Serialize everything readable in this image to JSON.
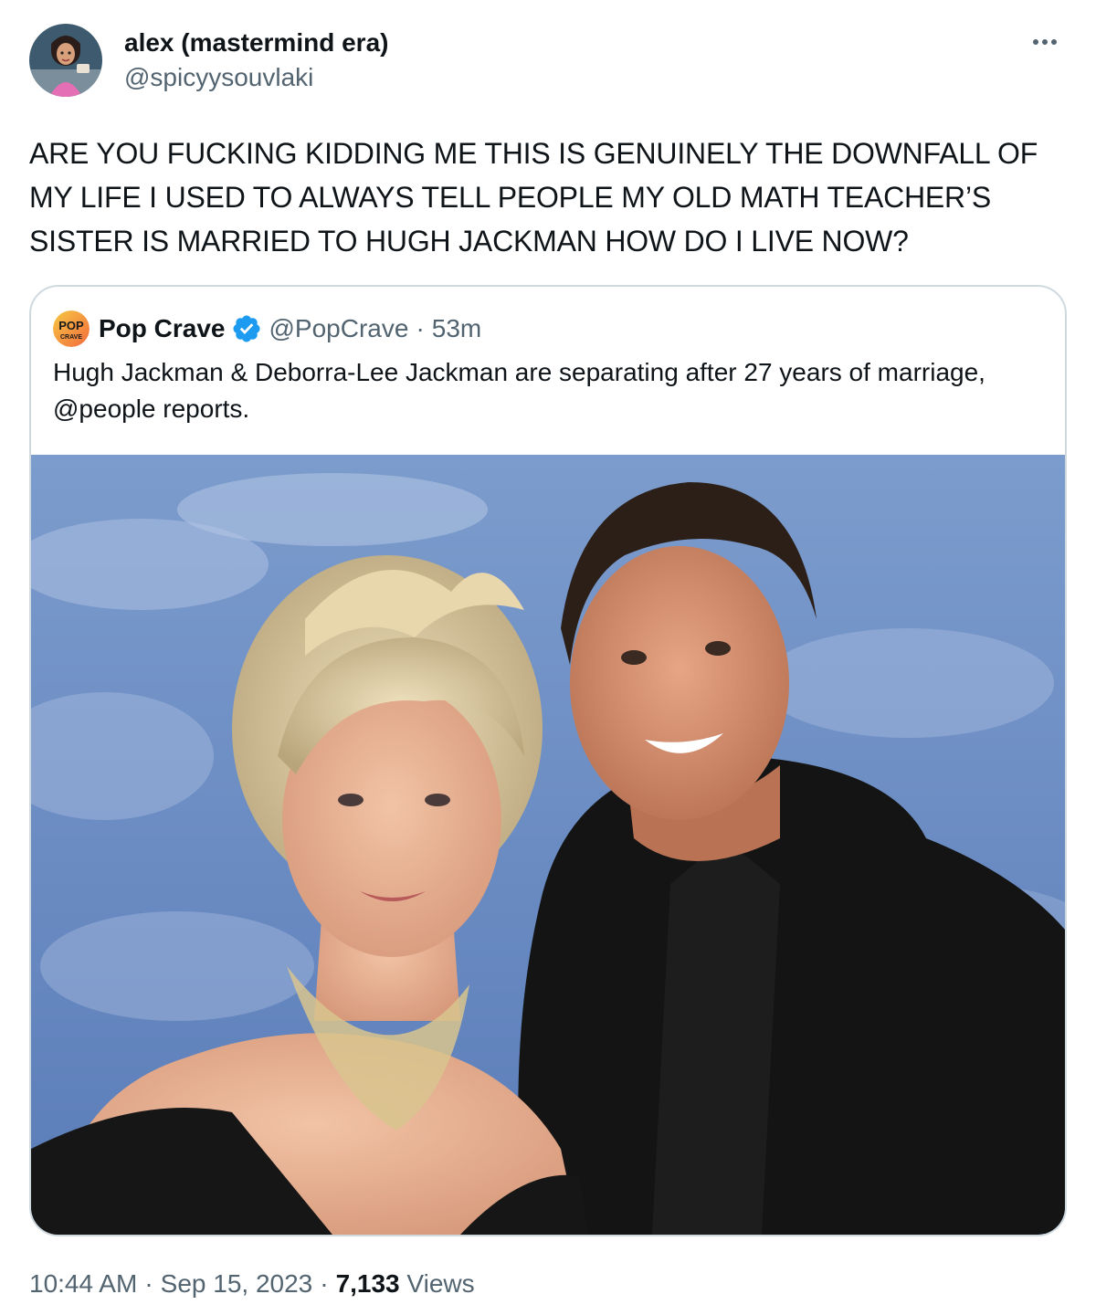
{
  "tweet": {
    "author": {
      "display_name": "alex (mastermind era)",
      "handle": "@spicyysouvlaki",
      "avatar_icon": "cartoon-avatar"
    },
    "more_icon": "more-options-icon",
    "text": "ARE YOU FUCKING KIDDING ME THIS IS GENUINELY THE DOWNFALL OF MY LIFE I USED TO ALWAYS TELL PEOPLE MY OLD MATH TEACHER’S SISTER IS MARRIED TO HUGH JACKMAN HOW DO I LIVE NOW?",
    "footer": {
      "time": "10:44 AM",
      "date": "Sep 15, 2023",
      "views_count": "7,133",
      "views_label": "Views",
      "separator": "·"
    }
  },
  "quoted": {
    "author": {
      "display_name": "Pop Crave",
      "handle": "@PopCrave",
      "time_ago": "53m",
      "separator": "·",
      "verified": true,
      "avatar_icon": "pop-crave-logo",
      "logo_text_top": "POP",
      "logo_text_bottom": "CRAVE"
    },
    "text": "Hugh Jackman & Deborra-Lee Jackman are separating after 27 years of marriage, @people reports.",
    "media": {
      "type": "photo"
    }
  },
  "colors": {
    "text_primary": "#0f1419",
    "text_secondary": "#536471",
    "border": "#cfd9de",
    "verified_blue": "#1d9bf0",
    "sky_blue": "#6f8fc4"
  }
}
